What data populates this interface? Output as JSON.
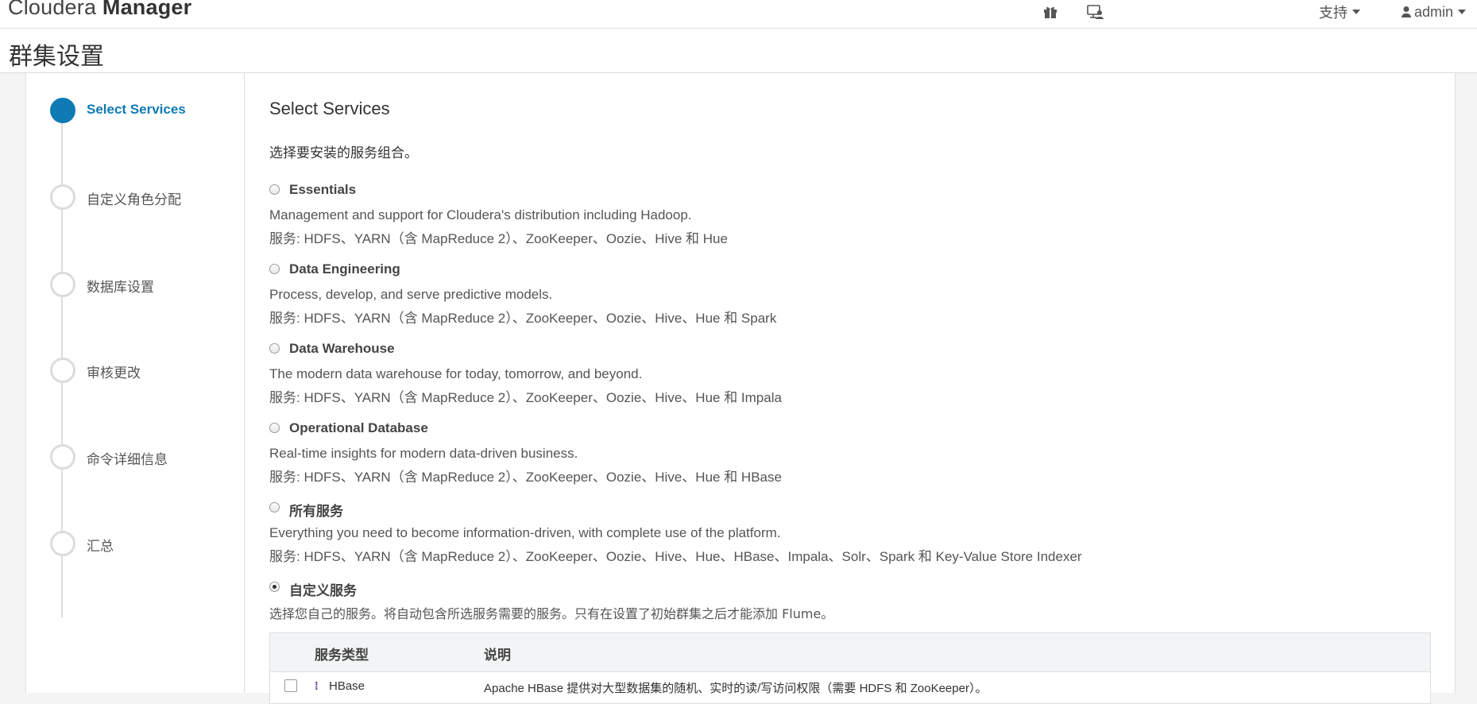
{
  "app": {
    "brand_light": "Cloudera",
    "brand_bold": "Manager"
  },
  "nav": {
    "support_label": "支持",
    "user_label": "admin"
  },
  "page_title": "群集设置",
  "wizard": {
    "steps": [
      {
        "label": "Select Services",
        "active": true
      },
      {
        "label": "自定义角色分配",
        "active": false
      },
      {
        "label": "数据库设置",
        "active": false
      },
      {
        "label": "审核更改",
        "active": false
      },
      {
        "label": "命令详细信息",
        "active": false
      },
      {
        "label": "汇总",
        "active": false
      }
    ]
  },
  "content": {
    "title": "Select Services",
    "intro": "选择要安装的服务组合。",
    "options": [
      {
        "name": "Essentials",
        "desc": "Management and support for Cloudera's distribution including Hadoop.",
        "services": "服务: HDFS、YARN（含 MapReduce 2）、ZooKeeper、Oozie、Hive 和 Hue",
        "checked": false
      },
      {
        "name": "Data Engineering",
        "desc": "Process, develop, and serve predictive models.",
        "services": "服务: HDFS、YARN（含 MapReduce 2）、ZooKeeper、Oozie、Hive、Hue 和 Spark",
        "checked": false
      },
      {
        "name": "Data Warehouse",
        "desc": "The modern data warehouse for today, tomorrow, and beyond.",
        "services": "服务: HDFS、YARN（含 MapReduce 2）、ZooKeeper、Oozie、Hive、Hue 和 Impala",
        "checked": false
      },
      {
        "name": "Operational Database",
        "desc": "Real-time insights for modern data-driven business.",
        "services": "服务: HDFS、YARN（含 MapReduce 2）、ZooKeeper、Oozie、Hive、Hue 和 HBase",
        "checked": false
      },
      {
        "name": "所有服务",
        "desc": "Everything you need to become information-driven, with complete use of the platform.",
        "services": "服务: HDFS、YARN（含 MapReduce 2）、ZooKeeper、Oozie、Hive、Hue、HBase、Impala、Solr、Spark 和 Key-Value Store Indexer",
        "checked": false
      },
      {
        "name": "自定义服务",
        "desc": "选择您自己的服务。将自动包含所选服务需要的服务。只有在设置了初始群集之后才能添加 Flume。",
        "services": "",
        "checked": true
      }
    ],
    "table": {
      "col_type": "服务类型",
      "col_desc": "说明",
      "rows": [
        {
          "name": "HBase",
          "desc": "Apache HBase 提供对大型数据集的随机、实时的读/写访问权限（需要 HDFS 和 ZooKeeper）。"
        }
      ]
    }
  },
  "colors": {
    "accent": "#0f7bb5",
    "hbase_icon": "#4a2b8f"
  },
  "icons": [
    "gift-icon",
    "monitor-user-icon",
    "caret-down-icon",
    "user-icon"
  ]
}
